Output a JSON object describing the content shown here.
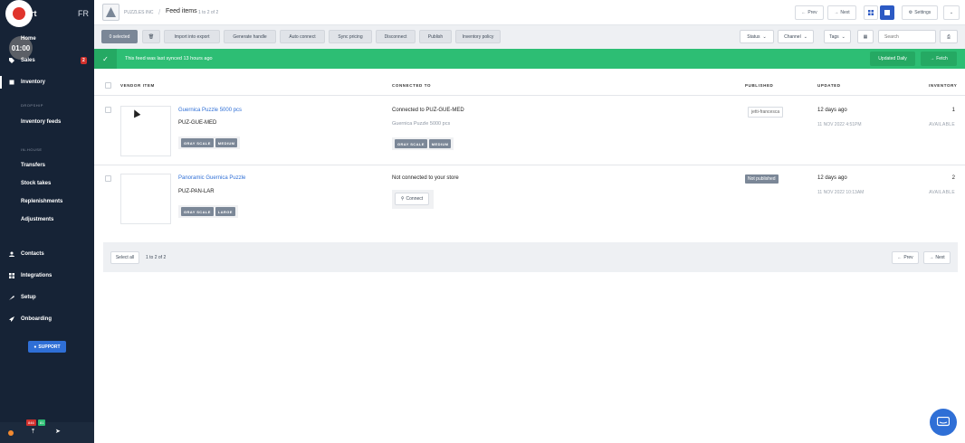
{
  "sidebar": {
    "brand_fragment": "rt",
    "language": "FR",
    "timer": "01:00",
    "items": [
      {
        "label": "Home",
        "icon": "home-icon"
      },
      {
        "label": "Sales",
        "icon": "tag-icon",
        "badge": "2"
      },
      {
        "label": "Inventory",
        "icon": "box-icon"
      },
      {
        "label": "Contacts",
        "icon": "person-icon"
      },
      {
        "label": "Integrations",
        "icon": "grid-icon"
      },
      {
        "label": "Setup",
        "icon": "wrench-icon"
      },
      {
        "label": "Onboarding",
        "icon": "rocket-icon"
      }
    ],
    "dropship_heading": "DROPSHIP",
    "inventory_feeds": "Inventory feeds",
    "inhouse_heading": "IN-HOUSE",
    "inhouse_items": [
      "Transfers",
      "Stock takes",
      "Replenishments",
      "Adjustments"
    ],
    "support_label": "SUPPORT",
    "bottom_badge_red": "846",
    "bottom_badge_green": "81"
  },
  "topbar": {
    "company": "PUZZLES INC",
    "title": "Feed items",
    "count": "1 to 2 of 2",
    "prev": "Prev",
    "next": "Next",
    "settings": "Settings"
  },
  "toolbar": {
    "selected": "0 selected",
    "actions": [
      "Import into export",
      "Generate handle",
      "Auto connect",
      "Sync pricing",
      "Disconnect",
      "Publish",
      "Inventory policy"
    ],
    "filters": [
      "Status",
      "Channel",
      "Tags"
    ],
    "search_placeholder": "Search"
  },
  "banner": {
    "message": "This feed was last synced 13 hours ago",
    "updated": "Updated Daily",
    "fetch": "Fetch"
  },
  "table": {
    "headers": {
      "vendor_item": "VENDOR ITEM",
      "connected_to": "CONNECTED TO",
      "published": "PUBLISHED",
      "updated": "UPDATED",
      "inventory": "INVENTORY"
    },
    "rows": [
      {
        "name": "Guernica Puzzle 5000 pcs",
        "sku": "PUZ-GUE-MED",
        "tags": [
          "GRAY SCALE",
          "MEDIUM"
        ],
        "connection": "Connected to PUZ-GUE-MED",
        "connection_sub": "Guernica Puzzle 5000 pcs",
        "connection_tags": [
          "GRAY SCALE",
          "MEDIUM"
        ],
        "published": "jetti-francesca",
        "updated": "12 days ago",
        "updated_sub": "11 NOV 2022 4:51PM",
        "inventory": "1",
        "inventory_sub": "AVAILABLE"
      },
      {
        "name": "Panoramic Guernica Puzzle",
        "sku": "PUZ-PAN-LAR",
        "tags": [
          "GRAY SCALE",
          "LARGE"
        ],
        "connection": "Not connected to your store",
        "connect_label": "Connect",
        "published": "Not published",
        "updated": "12 days ago",
        "updated_sub": "11 NOV 2022 10:13AM",
        "inventory": "2",
        "inventory_sub": "AVAILABLE"
      }
    ]
  },
  "footer": {
    "select_all": "Select all",
    "count": "1 to 2 of 2",
    "prev": "Prev",
    "next": "Next"
  },
  "colors": {
    "sidebar": "#162336",
    "accent": "#2f6fd6",
    "banner": "#2dbe74",
    "badge": "#d0302c"
  }
}
